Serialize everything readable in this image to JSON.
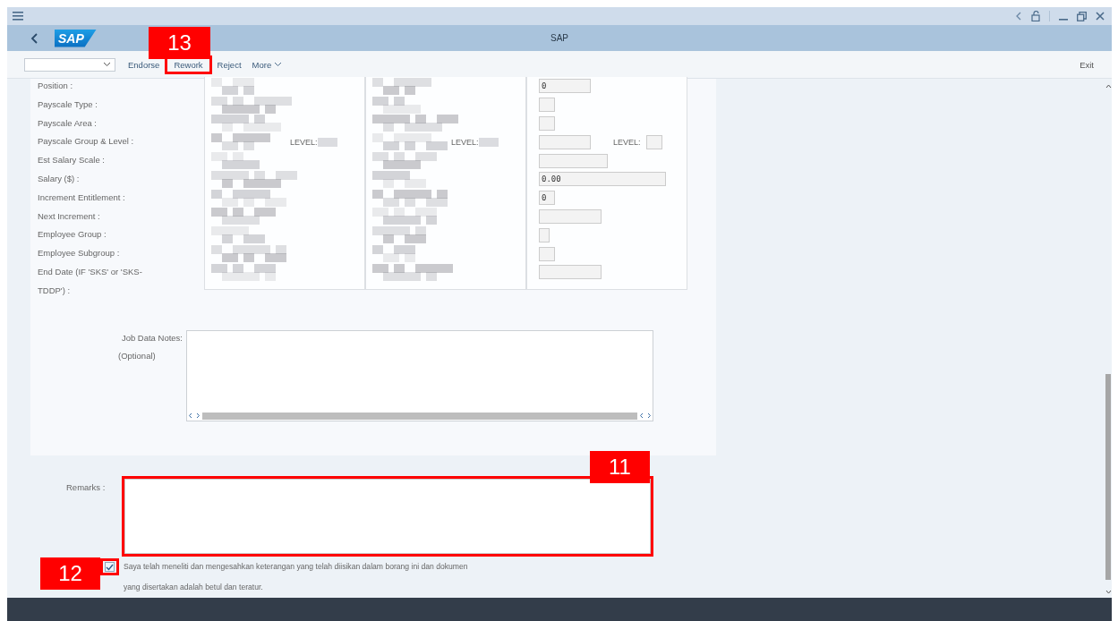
{
  "window": {
    "title": "SAP",
    "logo": "SAP"
  },
  "toolbar": {
    "actions": [
      "Endorse",
      "Rework",
      "Reject"
    ],
    "more": "More",
    "exit": "Exit"
  },
  "rows": [
    {
      "label": "Position :",
      "field": "0"
    },
    {
      "label": "Payscale Type :"
    },
    {
      "label": "Payscale Area :"
    },
    {
      "label": "Payscale Group & Level :",
      "level_labels": [
        "LEVEL:",
        "LEVEL:",
        "LEVEL:"
      ]
    },
    {
      "label": "Est Salary Scale :"
    },
    {
      "label": "Salary ($) :",
      "field": "0.00"
    },
    {
      "label": "Increment Entitlement :",
      "field": "0"
    },
    {
      "label": "Next Increment :"
    },
    {
      "label": "Employee Group :"
    },
    {
      "label": "Employee Subgroup :"
    },
    {
      "label": "End Date (IF 'SKS' or 'SKS-TDDP') :"
    }
  ],
  "notes": {
    "label": "Job Data Notes:",
    "hint": "(Optional)"
  },
  "remarks": {
    "label": "Remarks :"
  },
  "declaration": {
    "checked": true,
    "text": "Saya telah meneliti dan mengesahkan keterangan yang telah diisikan dalam borang ini dan dokumen yang disertakan adalah betul dan teratur."
  },
  "annotations": [
    {
      "text": "13"
    },
    {
      "text": "11"
    },
    {
      "text": "12"
    }
  ]
}
